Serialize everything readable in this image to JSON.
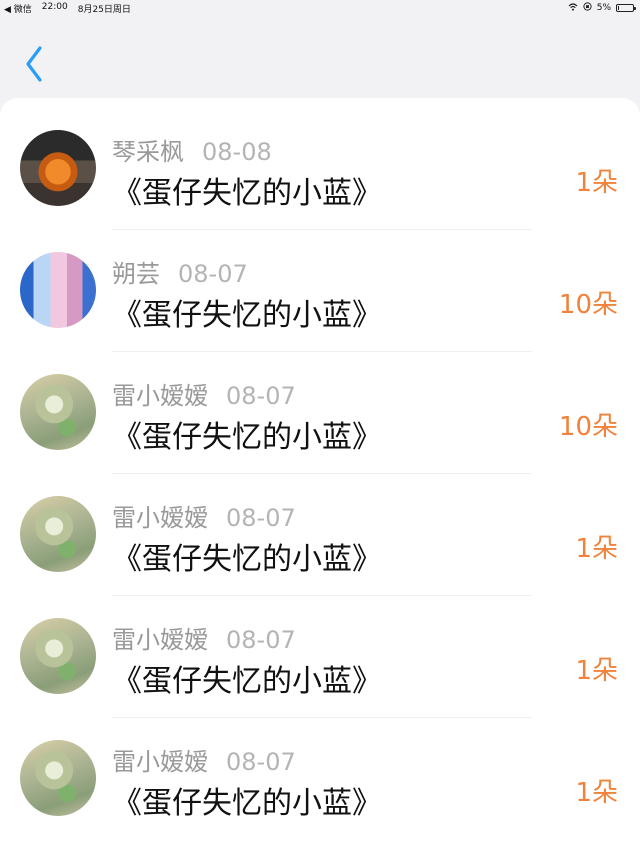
{
  "status_bar": {
    "back_app": "◀ 微信",
    "time": "22:00",
    "date": "8月25日周日",
    "battery": "5%",
    "battery_level": 0.05
  },
  "nav": {
    "back_icon": "chevron-left-icon"
  },
  "list": [
    {
      "name": "琴采枫",
      "date": "08-08",
      "title": "《蛋仔失忆的小蓝》",
      "amount": "1朵"
    },
    {
      "name": "朔芸",
      "date": "08-07",
      "title": "《蛋仔失忆的小蓝》",
      "amount": "10朵"
    },
    {
      "name": "雷小嫒嫒",
      "date": "08-07",
      "title": "《蛋仔失忆的小蓝》",
      "amount": "10朵"
    },
    {
      "name": "雷小嫒嫒",
      "date": "08-07",
      "title": "《蛋仔失忆的小蓝》",
      "amount": "1朵"
    },
    {
      "name": "雷小嫒嫒",
      "date": "08-07",
      "title": "《蛋仔失忆的小蓝》",
      "amount": "1朵"
    },
    {
      "name": "雷小嫒嫒",
      "date": "08-07",
      "title": "《蛋仔失忆的小蓝》",
      "amount": "1朵"
    }
  ],
  "colors": {
    "accent": "#2a9df4",
    "amount": "#f0823c",
    "name": "#999999",
    "title": "#111111",
    "background": "#f2f2f4"
  }
}
